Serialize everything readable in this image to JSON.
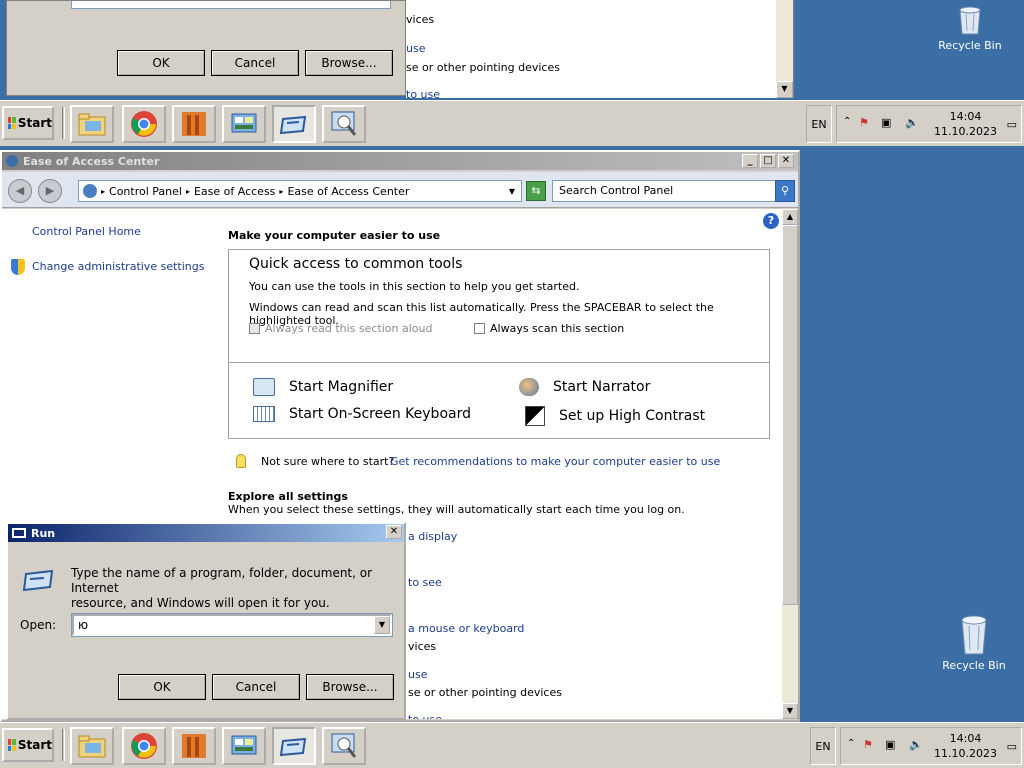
{
  "desktop": {
    "recycle_bin_top": "Recycle Bin",
    "recycle_bin_bottom": "Recycle Bin"
  },
  "taskbar": {
    "start": "Start",
    "lang": "EN",
    "time": "14:04",
    "date": "11.10.2023"
  },
  "ease": {
    "title": "Ease of Access Center",
    "breadcrumb": [
      "Control Panel",
      "Ease of Access",
      "Ease of Access Center"
    ],
    "search_placeholder": "Search Control Panel",
    "sidebar": {
      "home": "Control Panel Home",
      "admin": "Change administrative settings"
    },
    "heading": "Make your computer easier to use",
    "quick": {
      "title": "Quick access to common tools",
      "line1": "You can use the tools in this section to help you get started.",
      "line2": "Windows can read and scan this list automatically.  Press the SPACEBAR to select the highlighted tool.",
      "read_aloud": "Always read this section aloud",
      "scan": "Always scan this section",
      "magnifier": "Start Magnifier",
      "narrator": "Start Narrator",
      "osk": "Start On-Screen Keyboard",
      "contrast": "Set up High Contrast"
    },
    "hint_question": "Not sure where to start?",
    "hint_link": "Get recommendations to make your computer easier to use",
    "explore_title": "Explore all settings",
    "explore_desc": "When you select these settings, they will automatically start each time you log on.",
    "partial": [
      "a display",
      "to see",
      "a mouse or keyboard",
      "vices",
      "use",
      "se or other pointing devices",
      "to use"
    ]
  },
  "top_fragment": {
    "partial": [
      "vices",
      "use",
      "se or other pointing devices",
      "to use"
    ],
    "ok": "OK",
    "cancel": "Cancel",
    "browse": "Browse..."
  },
  "run": {
    "title": "Run",
    "desc_line1": "Type the name of a program, folder, document, or Internet",
    "desc_line2": "resource, and Windows will open it for you.",
    "open_label": "Open:",
    "open_value": "ю",
    "ok": "OK",
    "cancel": "Cancel",
    "browse": "Browse..."
  }
}
